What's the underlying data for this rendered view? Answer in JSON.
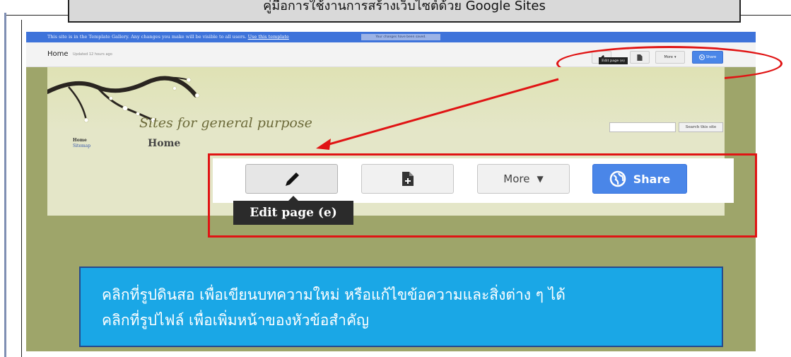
{
  "doc": {
    "heading": "คู่มือการใช้งานการสร้างเว็บไซต์ด้วย Google Sites"
  },
  "gallery_bar": {
    "notice": "This site is in the Template Gallery. Any changes you make will be visible to all users.",
    "link": "Use this template",
    "saved": "Your changes have been saved."
  },
  "header": {
    "page_tab": "Home",
    "updated": "Updated 12 hours ago",
    "more_label": "More",
    "share_label": "Share",
    "tooltip": "Edit page (e)"
  },
  "site": {
    "title": "Sites for general purpose",
    "search_button": "Search this site",
    "nav": [
      "Home",
      "Sitemap"
    ],
    "page_heading": "Home"
  },
  "zoom_toolbar": {
    "more_label": "More",
    "share_label": "Share",
    "tooltip": "Edit page (e)"
  },
  "instructions": {
    "line1": "คลิกที่รูปดินสอ  เพื่อเขียนบทความใหม่  หรือแก้ไขข้อความและสิ่งต่าง ๆ ได้",
    "line2": "คลิกที่รูปไฟล์    เพื่อเพิ่มหน้าของหัวข้อสำคัญ"
  },
  "colors": {
    "accent_red": "#e01414",
    "share_blue": "#4a86e8",
    "instruction_bg": "#1aa7e6",
    "site_bg": "#9ea56a"
  }
}
